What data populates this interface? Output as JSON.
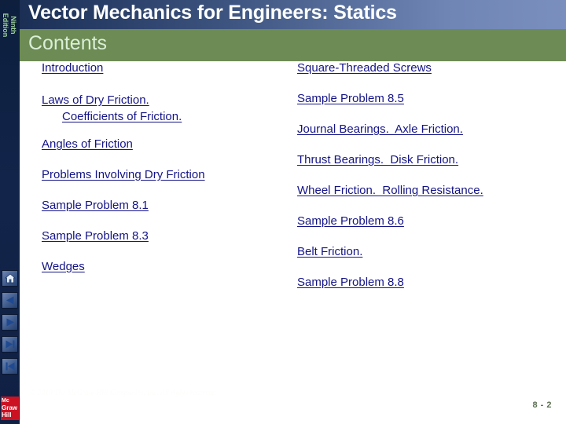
{
  "header": {
    "title": "Vector Mechanics for Engineers: Statics",
    "subtitle": "Contents"
  },
  "sidebar": {
    "edition_line1": "Ninth",
    "edition_line2": "Edition",
    "nav": [
      {
        "name": "home",
        "label": "Home"
      },
      {
        "name": "previous",
        "label": "Previous"
      },
      {
        "name": "next",
        "label": "Next"
      },
      {
        "name": "last",
        "label": "Last"
      },
      {
        "name": "first",
        "label": "First"
      }
    ],
    "logo": {
      "line1": "Mc",
      "line2": "Graw",
      "line3": "Hill"
    }
  },
  "contents": {
    "left_column": [
      {
        "text": "Introduction"
      },
      {
        "text": "Laws of Dry Friction.",
        "text2": "Coefficients of Friction."
      },
      {
        "text": "Angles of Friction"
      },
      {
        "text": "Problems Involving Dry Friction"
      },
      {
        "text": "Sample Problem 8.1"
      },
      {
        "text": "Sample Problem 8.3"
      },
      {
        "text": "Wedges"
      }
    ],
    "right_column": [
      {
        "text": "Square-Threaded Screws"
      },
      {
        "text": "Sample Problem 8.5"
      },
      {
        "text": "Journal Bearings.  Axle Friction."
      },
      {
        "text": "Thrust Bearings.  Disk Friction."
      },
      {
        "text": "Wheel Friction.  Rolling Resistance."
      },
      {
        "text": "Sample Problem 8.6"
      },
      {
        "text": "Belt Friction."
      },
      {
        "text": "Sample Problem 8.8"
      }
    ]
  },
  "footer": {
    "copyright": "© 2010 The McGraw-Hill Companies, Inc. All rights reserved.",
    "page_number": "8 - 2"
  },
  "colors": {
    "header_dark": "#1b2f55",
    "header_light": "#7a8fbd",
    "green_band": "#6d8b54",
    "link_blue": "#141487",
    "sidebar_navy": "#0d1f3d",
    "logo_red": "#cc1122",
    "subtitle_green": "#d9efd6",
    "page_number_gray": "#5d6f52"
  }
}
